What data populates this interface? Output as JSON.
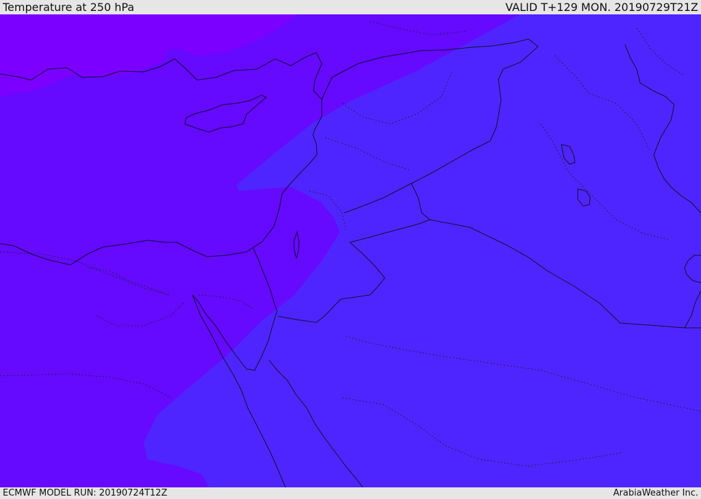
{
  "header": {
    "title": "Temperature at 250 hPa",
    "valid_time": "VALID T+129 MON. 20190729T21Z"
  },
  "footer": {
    "model_run": "ECMWF MODEL RUN: 20190724T12Z",
    "credit": "ArabiaWeather Inc."
  },
  "map": {
    "field": "temperature",
    "pressure_level": "250 hPa",
    "region": "Eastern Mediterranean and Middle East",
    "colors": {
      "coldest": "#7b00ff",
      "colder": "#6609ff",
      "cool": "#4f25ff",
      "border": "#0b1133",
      "admin_border": "#1b1f4a"
    },
    "style": {
      "coastlines": "solid",
      "national_borders": "solid",
      "internal_boundaries": "dotted"
    }
  }
}
